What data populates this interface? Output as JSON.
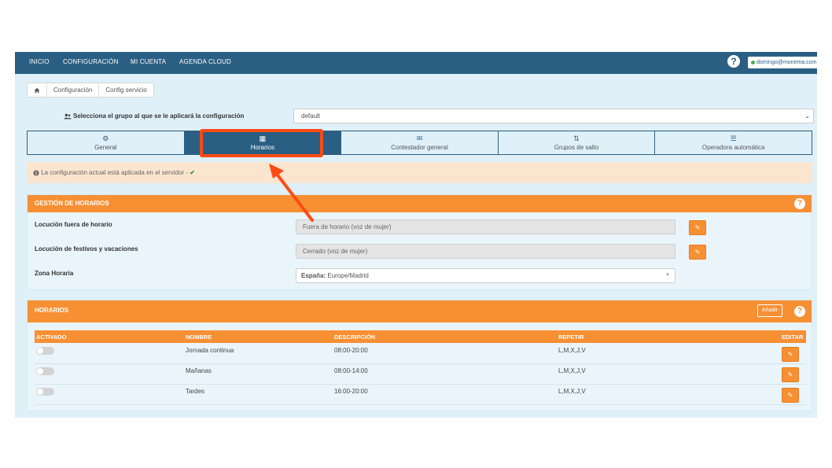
{
  "nav": {
    "items": [
      "INICIO",
      "CONFIGURACIÓN",
      "MI CUENTA",
      "AGENDA CLOUD"
    ],
    "help": "?",
    "user_email": "domingo@monema.com"
  },
  "breadcrumb": {
    "home_icon": "home-icon",
    "items": [
      "Configuración",
      "Config servicio"
    ]
  },
  "group": {
    "label": "Selecciona el grupo al que se le aplicará la configuración",
    "icon": "users-icon",
    "value": "default"
  },
  "tabs": [
    {
      "label": "General",
      "icon": "gear-icon",
      "glyph": "⚙"
    },
    {
      "label": "Horarios",
      "icon": "calendar-icon",
      "glyph": "▦"
    },
    {
      "label": "Contestador general",
      "icon": "envelope-icon",
      "glyph": "✉"
    },
    {
      "label": "Grupos de salto",
      "icon": "sort-icon",
      "glyph": "⇅"
    },
    {
      "label": "Operadora automática",
      "icon": "list-icon",
      "glyph": "☰"
    }
  ],
  "active_tab": 1,
  "alert": {
    "icon": "info-icon",
    "text": "La configuración actual está aplicada en el servidor -",
    "check": "✔"
  },
  "gestion": {
    "title": "GESTIÓN DE HORARIOS",
    "help": "?",
    "fuera_label": "Locución fuera de horario",
    "fuera_value": "Fuera de horario (voz de mujer)",
    "festivos_label": "Locución de festivos y vacaciones",
    "festivos_value": "Cerrado (voz de mujer)",
    "zona_label": "Zona Horaria",
    "zona_country": "España:",
    "zona_value": "Europe/Madrid",
    "edit_glyph": "✎"
  },
  "horarios": {
    "title": "HORARIOS",
    "add_label": "Añadir",
    "help": "?",
    "columns": [
      "ACTIVADO",
      "NOMBRE",
      "DESCRIPCIÓN",
      "REPETIR",
      "EDITAR"
    ],
    "rows": [
      {
        "nombre": "Jornada continua",
        "descripcion": "08:00-20:00",
        "repetir": "L,M,X,J,V",
        "activado": false
      },
      {
        "nombre": "Mañanas",
        "descripcion": "08:00-14:00",
        "repetir": "L,M,X,J,V",
        "activado": false
      },
      {
        "nombre": "Tardes",
        "descripcion": "16:00-20:00",
        "repetir": "L,M,X,J,V",
        "activado": false
      }
    ]
  },
  "colors": {
    "nav": "#2a5f83",
    "accent": "#f78f33",
    "highlight": "#ff4a14",
    "background": "#dff0f9"
  }
}
